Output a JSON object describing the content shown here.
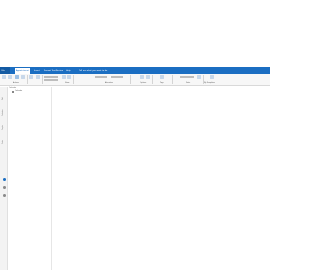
{
  "ribbon_tabs": [
    "File",
    "Appointment",
    "Insert",
    "Format Text",
    "Review",
    "Help",
    "Tell me what you want to do"
  ],
  "colors": {
    "accent": "#1b6ec2",
    "accent_dark": "#125aa3"
  },
  "ribbon_groups": [
    "Actions",
    "Show",
    "Attendees",
    "Options",
    "Tags",
    "Voice",
    "My Templates"
  ],
  "folder_pane": {
    "header": "Calendar",
    "item_label": "Calendar"
  },
  "left_nav": [
    "Mail",
    "Calendar",
    "People",
    "Tasks"
  ]
}
